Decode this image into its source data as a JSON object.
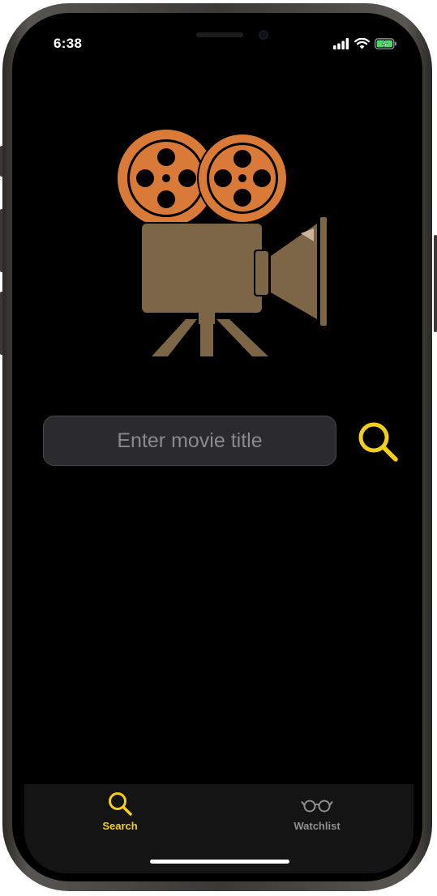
{
  "status_bar": {
    "time": "6:38",
    "icons": [
      "cellular-signal-icon",
      "wifi-icon",
      "battery-charging-icon"
    ]
  },
  "logo": {
    "icon": "movie-camera-icon",
    "colors": {
      "reel": "#d97a38",
      "body": "#7d6646"
    }
  },
  "search": {
    "placeholder": "Enter movie title",
    "value": "",
    "button_icon": "search-icon"
  },
  "tab_bar": {
    "tabs": [
      {
        "label": "Search",
        "icon": "search-icon",
        "active": true
      },
      {
        "label": "Watchlist",
        "icon": "glasses-icon",
        "active": false
      }
    ]
  },
  "colors": {
    "accent": "#f2cf18",
    "background": "#000000",
    "tab_bar_background": "#141414",
    "inactive_tab": "#8e8e93"
  }
}
